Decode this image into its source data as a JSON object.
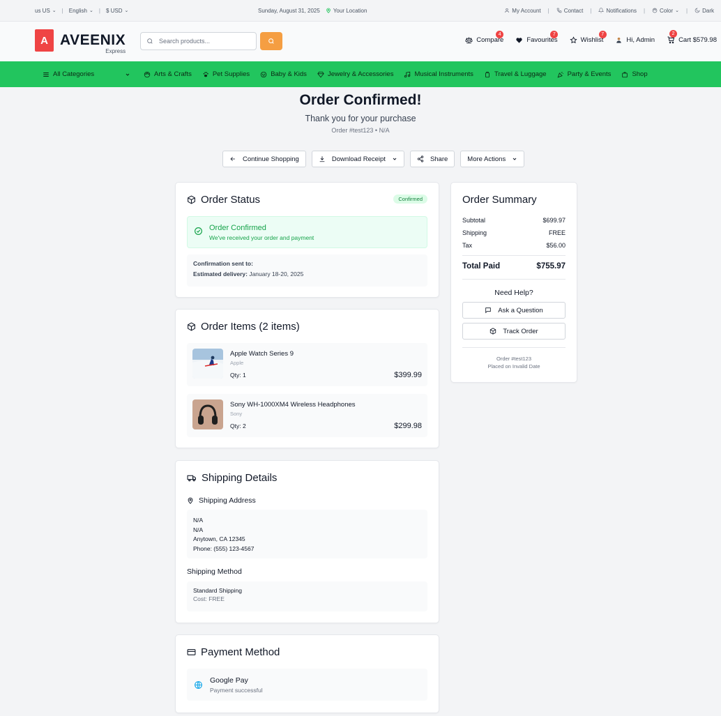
{
  "topbar": {
    "locale": "us US",
    "language": "English",
    "currency": "$ USD",
    "date": "Sunday, August 31, 2025",
    "location": "Your Location",
    "account": "My Account",
    "contact": "Contact",
    "notifications": "Notifications",
    "color": "Color",
    "theme": "Dark"
  },
  "header": {
    "logo_letter": "A",
    "brand": "AVEENIX",
    "brand_sub": "Express",
    "search_placeholder": "Search products...",
    "compare": "Compare",
    "compare_count": "4",
    "favourites": "Favourites",
    "favourites_count": "7",
    "wishlist": "Wishlist",
    "wishlist_count": "7",
    "greeting": "Hi, Admin",
    "cart": "Cart $579.98",
    "cart_count": "2"
  },
  "nav": {
    "all_categories": "All Categories",
    "items": [
      "Arts & Crafts",
      "Pet Supplies",
      "Baby & Kids",
      "Jewelry & Accessories",
      "Musical Instruments",
      "Travel & Luggage",
      "Party & Events",
      "Shop"
    ]
  },
  "page": {
    "title": "Order Confirmed!",
    "thanks": "Thank you for your purchase",
    "order_line": "Order #test123 • N/A",
    "buttons": {
      "continue": "Continue Shopping",
      "download": "Download Receipt",
      "share": "Share",
      "more": "More Actions"
    }
  },
  "order_status": {
    "heading": "Order Status",
    "pill": "Confirmed",
    "box_title": "Order Confirmed",
    "box_sub": "We've received your order and payment",
    "sent_to_label": "Confirmation sent to:",
    "delivery_label": "Estimated delivery:",
    "delivery_value": "January 18-20, 2025"
  },
  "order_items": {
    "heading": "Order Items (2 items)",
    "items": [
      {
        "name": "Apple Watch Series 9",
        "brand": "Apple",
        "qty": "Qty: 1",
        "price": "$399.99"
      },
      {
        "name": "Sony WH-1000XM4 Wireless Headphones",
        "brand": "Sony",
        "qty": "Qty: 2",
        "price": "$299.98"
      }
    ]
  },
  "shipping": {
    "heading": "Shipping Details",
    "address_label": "Shipping Address",
    "address_lines": [
      "N/A",
      "N/A",
      "Anytown, CA 12345",
      "Phone: (555) 123-4567"
    ],
    "method_label": "Shipping Method",
    "method_name": "Standard Shipping",
    "method_cost": "Cost: FREE"
  },
  "payment": {
    "heading": "Payment Method",
    "name": "Google Pay",
    "status": "Payment successful"
  },
  "summary": {
    "heading": "Order Summary",
    "subtotal_label": "Subtotal",
    "subtotal": "$699.97",
    "shipping_label": "Shipping",
    "shipping": "FREE",
    "tax_label": "Tax",
    "tax": "$56.00",
    "total_label": "Total Paid",
    "total": "$755.97",
    "help_heading": "Need Help?",
    "ask": "Ask a Question",
    "track": "Track Order",
    "footer_order": "Order #test123",
    "footer_placed": "Placed on Invalid Date"
  },
  "colors": {
    "accent_green": "#22c55e",
    "brand_red": "#ef4444",
    "search_orange": "#f59e42",
    "badge_red": "#ef4444"
  }
}
